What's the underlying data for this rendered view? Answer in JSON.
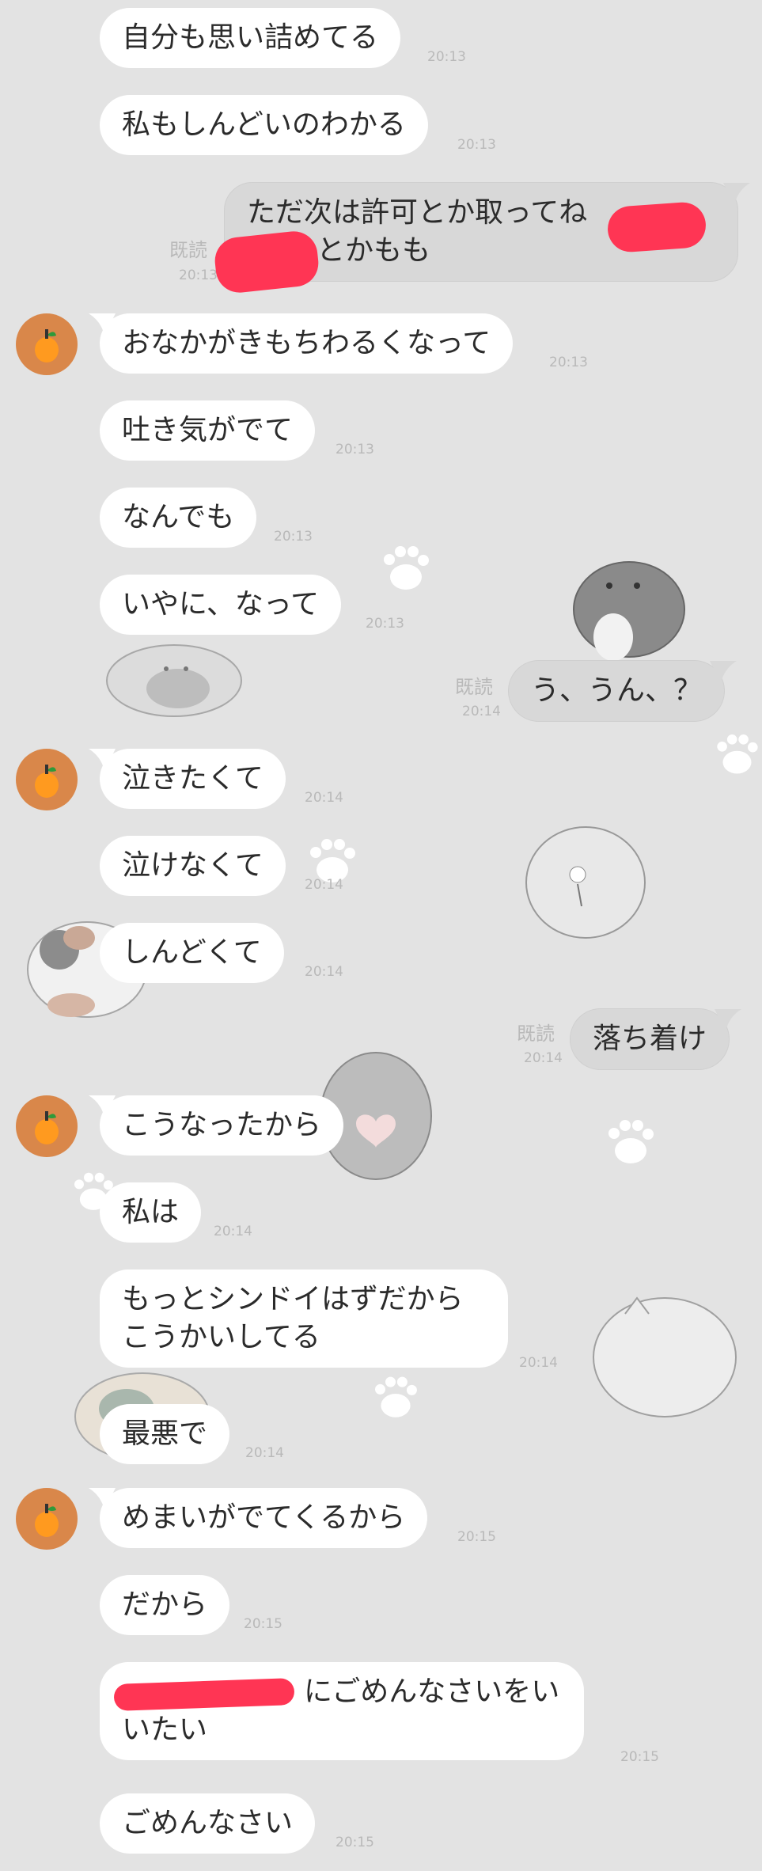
{
  "messages": {
    "m1": {
      "text": "自分も思い詰めてる",
      "time": "20:13"
    },
    "m2": {
      "text": "私もしんどいのわかる",
      "time": "20:13"
    },
    "m3": {
      "line1": "ただ次は許可とか取ってね",
      "line2": "とかもも",
      "read": "既読",
      "time": "20:13"
    },
    "m4": {
      "text": "おなかがきもちわるくなって",
      "time": "20:13"
    },
    "m5": {
      "text": "吐き気がでて",
      "time": "20:13"
    },
    "m6": {
      "text": "なんでも",
      "time": "20:13"
    },
    "m7": {
      "text": "いやに、なって",
      "time": "20:13"
    },
    "m8": {
      "text": "う、うん、？",
      "read": "既読",
      "time": "20:14"
    },
    "m9": {
      "text": "泣きたくて",
      "time": "20:14"
    },
    "m10": {
      "text": "泣けなくて",
      "time": "20:14"
    },
    "m11": {
      "text": "しんどくて",
      "time": "20:14"
    },
    "m12": {
      "text": "落ち着け",
      "read": "既読",
      "time": "20:14"
    },
    "m13": {
      "text": "こうなったから",
      "time": "20:14"
    },
    "m14": {
      "text": "私は",
      "time": "20:14"
    },
    "m15": {
      "line1": "もっとシンドイはずだから",
      "line2": "こうかいしてる",
      "time": "20:14"
    },
    "m16": {
      "text": "最悪で",
      "time": "20:14"
    },
    "m17": {
      "text": "めまいがでてくるから",
      "time": "20:15"
    },
    "m18": {
      "text": "だから",
      "time": "20:15"
    },
    "m19": {
      "line1": "にごめんなさいをい",
      "line2": "いたい",
      "time": "20:15"
    },
    "m20": {
      "text": "ごめんなさい",
      "time": "20:15"
    }
  },
  "colors": {
    "background": "#e3e3e3",
    "incoming_bubble": "#ffffff",
    "outgoing_bubble": "#d8d8d8",
    "avatar": "#d9874a",
    "redaction": "#ff3554"
  },
  "icons": {
    "avatar": "orange-fruit-icon",
    "background": "cat-sticker-wallpaper"
  }
}
